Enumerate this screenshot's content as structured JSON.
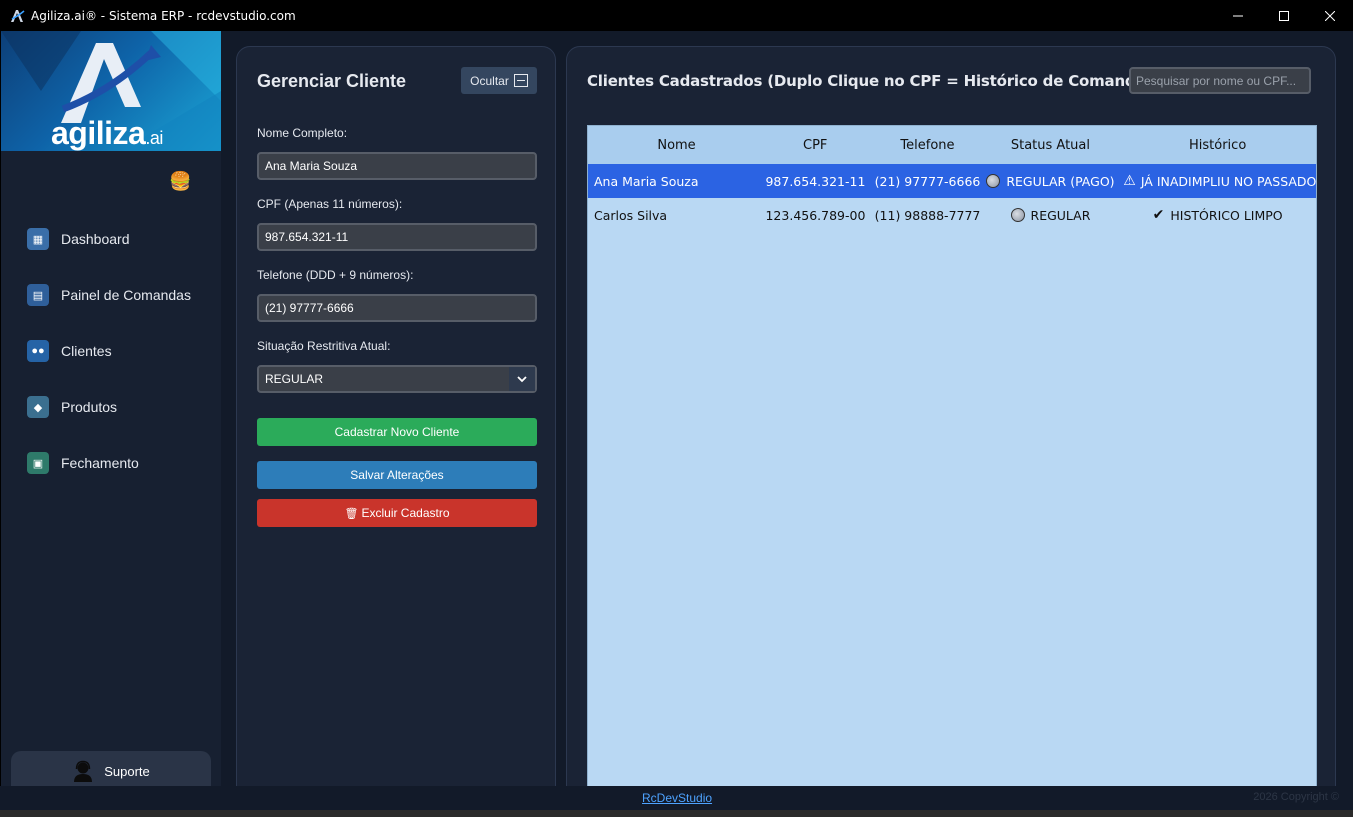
{
  "window": {
    "title": "Agiliza.ai® - Sistema ERP - rcdevstudio.com",
    "controls": [
      "minimize",
      "maximize",
      "close"
    ]
  },
  "brand": {
    "name": "agiliza",
    "suffix": ".ai"
  },
  "sidebar": {
    "items": [
      {
        "label": "Dashboard",
        "icon": "dashboard-icon",
        "color": "#3a6ea8"
      },
      {
        "label": "Painel de Comandas",
        "icon": "commands-icon",
        "color": "#2f5f9a"
      },
      {
        "label": "Clientes",
        "icon": "clients-icon",
        "color": "#2563a6"
      },
      {
        "label": "Produtos",
        "icon": "products-icon",
        "color": "#3b6f8f"
      },
      {
        "label": "Fechamento",
        "icon": "closing-icon",
        "color": "#2e7a6a"
      }
    ],
    "support_label": "Suporte"
  },
  "form": {
    "title": "Gerenciar Cliente",
    "hide_label": "Ocultar",
    "name_label": "Nome Completo:",
    "name_value": "Ana Maria Souza",
    "cpf_label": "CPF (Apenas 11 números):",
    "cpf_value": "987.654.321-11",
    "phone_label": "Telefone (DDD + 9 números):",
    "phone_value": "(21) 97777-6666",
    "status_label": "Situação Restritiva Atual:",
    "status_value": "REGULAR",
    "btn_new": "Cadastrar Novo Cliente",
    "btn_save": "Salvar Alterações",
    "btn_delete": "Excluir Cadastro"
  },
  "clients": {
    "title": "Clientes Cadastrados (Duplo Clique no CPF = Histórico de Comandas)",
    "search_placeholder": "Pesquisar por nome ou CPF...",
    "columns": [
      "Nome",
      "CPF",
      "Telefone",
      "Status Atual",
      "Histórico"
    ],
    "rows": [
      {
        "nome": "Ana Maria Souza",
        "cpf": "987.654.321-11",
        "telefone": "(21) 97777-6666",
        "status": "REGULAR (PAGO)",
        "historico": "JÁ INADIMPLIU NO PASSADO",
        "selected": true
      },
      {
        "nome": "Carlos Silva",
        "cpf": "123.456.789-00",
        "telefone": "(11) 98888-7777",
        "status": "REGULAR",
        "historico": "HISTÓRICO LIMPO",
        "selected": false
      }
    ]
  },
  "footer": {
    "link": "RcDevStudio",
    "copyright": "2026 Copyright ©"
  },
  "colors": {
    "accent_green": "#2bab5a",
    "accent_blue": "#2d7db9",
    "accent_red": "#c9342b",
    "selected_row": "#2b63e3"
  }
}
